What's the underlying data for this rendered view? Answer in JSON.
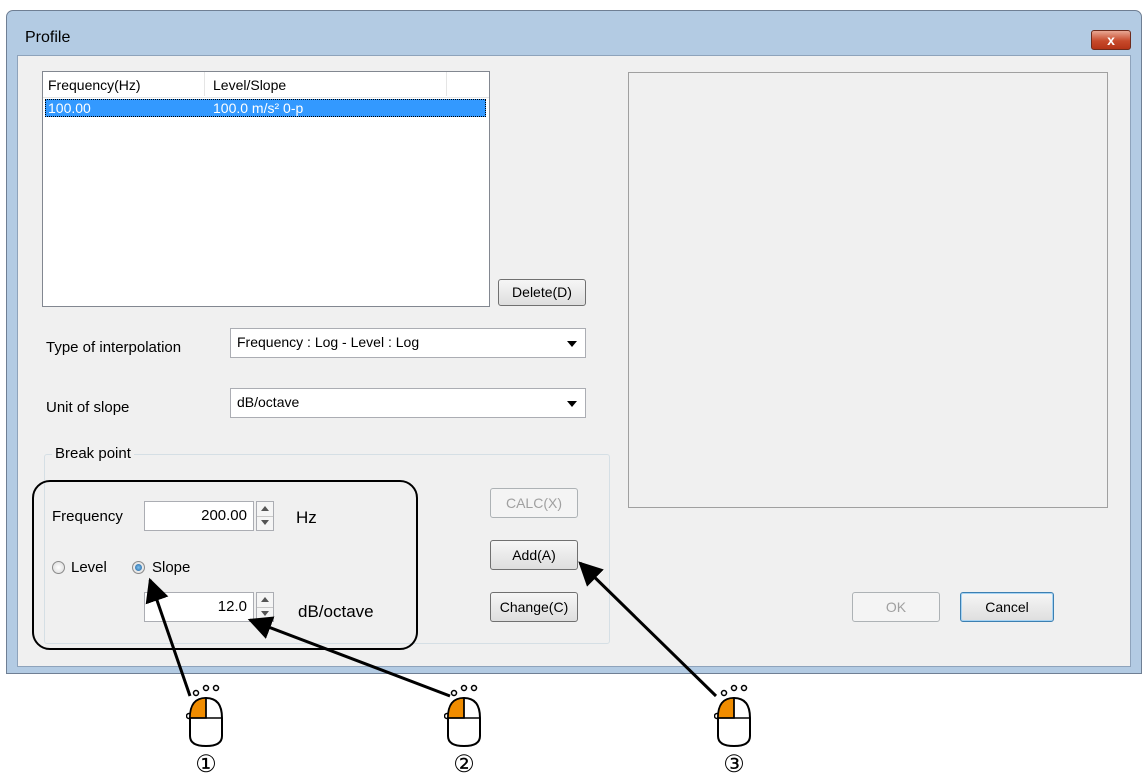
{
  "window": {
    "title": "Profile",
    "close_label": "x"
  },
  "list": {
    "columns": [
      "Frequency(Hz)",
      "Level/Slope"
    ],
    "rows": [
      {
        "frequency": "100.00",
        "level": "100.0 m/s² 0-p"
      }
    ]
  },
  "buttons": {
    "delete": "Delete(D)",
    "calc": "CALC(X)",
    "add": "Add(A)",
    "change": "Change(C)",
    "ok": "OK",
    "cancel": "Cancel"
  },
  "interpolation": {
    "label": "Type of interpolation",
    "value": "Frequency : Log - Level : Log"
  },
  "slope_unit": {
    "label": "Unit of slope",
    "value": "dB/octave"
  },
  "breakpoint": {
    "title": "Break point",
    "frequency_label": "Frequency",
    "frequency_value": "200.00",
    "frequency_unit": "Hz",
    "level_label": "Level",
    "slope_label": "Slope",
    "selected": "Slope",
    "slope_value": "12.0",
    "slope_unit": "dB/octave"
  },
  "steps": [
    "①",
    "②",
    "③"
  ],
  "colors": {
    "selection": "#3399ff",
    "mouse_button": "#f08c00"
  }
}
